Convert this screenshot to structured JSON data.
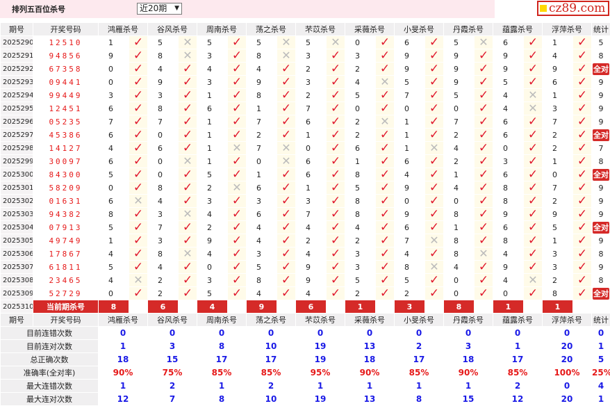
{
  "header": {
    "title": "排列五百位杀号",
    "period_select": "近20期",
    "site": "cz89.com"
  },
  "columns": [
    "期号",
    "开奖号码",
    "鸿雁杀号",
    "谷风杀号",
    "周南杀号",
    "荡之杀号",
    "芣苡杀号",
    "采薇杀号",
    "小旻杀号",
    "丹霞杀号",
    "蕴露杀号",
    "浮萍杀号",
    "统计"
  ],
  "rows": [
    {
      "p": "2025290",
      "d": "12510",
      "k": [
        1,
        5,
        5,
        5,
        5,
        0,
        6,
        5,
        6,
        1
      ],
      "r": [
        1,
        0,
        1,
        0,
        0,
        1,
        1,
        0,
        1,
        1
      ],
      "s": "5"
    },
    {
      "p": "2025291",
      "d": "94856",
      "k": [
        9,
        8,
        3,
        8,
        3,
        3,
        9,
        9,
        9,
        4
      ],
      "r": [
        1,
        0,
        1,
        0,
        1,
        1,
        1,
        1,
        1,
        1
      ],
      "s": "8"
    },
    {
      "p": "2025292",
      "d": "67358",
      "k": [
        0,
        4,
        4,
        4,
        2,
        2,
        9,
        9,
        9,
        9
      ],
      "r": [
        1,
        1,
        1,
        1,
        1,
        1,
        1,
        1,
        1,
        1
      ],
      "s": "全对"
    },
    {
      "p": "2025293",
      "d": "09441",
      "k": [
        0,
        9,
        3,
        9,
        3,
        4,
        5,
        9,
        5,
        6
      ],
      "r": [
        1,
        1,
        1,
        1,
        1,
        0,
        1,
        1,
        1,
        1
      ],
      "s": "9"
    },
    {
      "p": "2025294",
      "d": "99449",
      "k": [
        3,
        3,
        1,
        8,
        2,
        5,
        7,
        5,
        4,
        1
      ],
      "r": [
        1,
        1,
        1,
        1,
        1,
        1,
        1,
        1,
        0,
        1
      ],
      "s": "9"
    },
    {
      "p": "2025295",
      "d": "12451",
      "k": [
        6,
        8,
        6,
        1,
        7,
        0,
        0,
        0,
        4,
        3
      ],
      "r": [
        1,
        1,
        1,
        1,
        1,
        1,
        1,
        1,
        0,
        1
      ],
      "s": "9"
    },
    {
      "p": "2025296",
      "d": "05235",
      "k": [
        7,
        7,
        1,
        7,
        6,
        2,
        1,
        7,
        6,
        7
      ],
      "r": [
        1,
        1,
        1,
        1,
        1,
        0,
        1,
        1,
        1,
        1
      ],
      "s": "9"
    },
    {
      "p": "2025297",
      "d": "45386",
      "k": [
        6,
        0,
        1,
        2,
        1,
        2,
        1,
        2,
        6,
        2
      ],
      "r": [
        1,
        1,
        1,
        1,
        1,
        1,
        1,
        1,
        1,
        1
      ],
      "s": "全对"
    },
    {
      "p": "2025298",
      "d": "14127",
      "k": [
        4,
        6,
        1,
        7,
        0,
        6,
        1,
        4,
        0,
        2
      ],
      "r": [
        1,
        1,
        0,
        0,
        1,
        1,
        0,
        1,
        1,
        1
      ],
      "s": "7"
    },
    {
      "p": "2025299",
      "d": "30097",
      "k": [
        6,
        0,
        1,
        0,
        6,
        1,
        6,
        2,
        3,
        1
      ],
      "r": [
        1,
        0,
        1,
        0,
        1,
        1,
        1,
        1,
        1,
        1
      ],
      "s": "8"
    },
    {
      "p": "2025300",
      "d": "84300",
      "k": [
        5,
        0,
        5,
        1,
        6,
        8,
        4,
        1,
        6,
        0
      ],
      "r": [
        1,
        1,
        1,
        1,
        1,
        1,
        1,
        1,
        1,
        1
      ],
      "s": "全对"
    },
    {
      "p": "2025301",
      "d": "58209",
      "k": [
        0,
        8,
        2,
        6,
        1,
        5,
        9,
        4,
        8,
        7
      ],
      "r": [
        1,
        1,
        0,
        1,
        1,
        1,
        1,
        1,
        1,
        1
      ],
      "s": "9"
    },
    {
      "p": "2025302",
      "d": "01631",
      "k": [
        6,
        4,
        3,
        3,
        3,
        8,
        0,
        0,
        8,
        2
      ],
      "r": [
        0,
        1,
        1,
        1,
        1,
        1,
        1,
        1,
        1,
        1
      ],
      "s": "9"
    },
    {
      "p": "2025303",
      "d": "94382",
      "k": [
        8,
        3,
        4,
        6,
        7,
        8,
        9,
        8,
        9,
        9
      ],
      "r": [
        1,
        0,
        1,
        1,
        1,
        1,
        1,
        1,
        1,
        1
      ],
      "s": "9"
    },
    {
      "p": "2025304",
      "d": "07913",
      "k": [
        5,
        7,
        2,
        4,
        4,
        4,
        6,
        1,
        6,
        5
      ],
      "r": [
        1,
        1,
        1,
        1,
        1,
        1,
        1,
        1,
        1,
        1
      ],
      "s": "全对"
    },
    {
      "p": "2025305",
      "d": "49749",
      "k": [
        1,
        3,
        9,
        4,
        2,
        2,
        7,
        8,
        8,
        1
      ],
      "r": [
        1,
        1,
        1,
        1,
        1,
        1,
        0,
        1,
        1,
        1
      ],
      "s": "9"
    },
    {
      "p": "2025306",
      "d": "17867",
      "k": [
        4,
        8,
        4,
        3,
        4,
        3,
        4,
        8,
        4,
        3
      ],
      "r": [
        1,
        0,
        1,
        1,
        1,
        1,
        1,
        0,
        1,
        1
      ],
      "s": "8"
    },
    {
      "p": "2025307",
      "d": "61811",
      "k": [
        5,
        4,
        0,
        5,
        9,
        3,
        8,
        4,
        9,
        3
      ],
      "r": [
        1,
        1,
        1,
        1,
        1,
        1,
        0,
        1,
        1,
        1
      ],
      "s": "9"
    },
    {
      "p": "2025308",
      "d": "23465",
      "k": [
        4,
        2,
        3,
        8,
        9,
        5,
        5,
        0,
        4,
        2
      ],
      "r": [
        0,
        1,
        1,
        1,
        1,
        1,
        1,
        1,
        0,
        1
      ],
      "s": "8"
    },
    {
      "p": "2025309",
      "d": "52729",
      "k": [
        0,
        2,
        5,
        4,
        4,
        2,
        2,
        0,
        0,
        8
      ],
      "r": [
        1,
        1,
        1,
        1,
        1,
        1,
        1,
        1,
        1,
        1
      ],
      "s": "全对"
    }
  ],
  "current": {
    "p": "2025310",
    "label": "当前期杀号",
    "k": [
      "8",
      "6",
      "4",
      "9",
      "6",
      "1",
      "3",
      "8",
      "1",
      "1"
    ]
  },
  "stats": [
    {
      "label": "目前连错次数",
      "v": [
        "0",
        "0",
        "0",
        "0",
        "0",
        "0",
        "0",
        "0",
        "0",
        "0",
        "0"
      ],
      "pct": false
    },
    {
      "label": "目前连对次数",
      "v": [
        "1",
        "3",
        "8",
        "10",
        "19",
        "13",
        "2",
        "3",
        "1",
        "20",
        "1"
      ],
      "pct": false
    },
    {
      "label": "总正确次数",
      "v": [
        "18",
        "15",
        "17",
        "17",
        "19",
        "18",
        "17",
        "18",
        "17",
        "20",
        "5"
      ],
      "pct": false
    },
    {
      "label": "准确率(全对率)",
      "v": [
        "90%",
        "75%",
        "85%",
        "85%",
        "95%",
        "90%",
        "85%",
        "90%",
        "85%",
        "100%",
        "25%"
      ],
      "pct": true
    },
    {
      "label": "最大连错次数",
      "v": [
        "1",
        "2",
        "1",
        "2",
        "1",
        "1",
        "1",
        "1",
        "2",
        "0",
        "4"
      ],
      "pct": false
    },
    {
      "label": "最大连对次数",
      "v": [
        "12",
        "7",
        "8",
        "10",
        "19",
        "13",
        "8",
        "15",
        "12",
        "20",
        "1"
      ],
      "pct": false
    }
  ]
}
